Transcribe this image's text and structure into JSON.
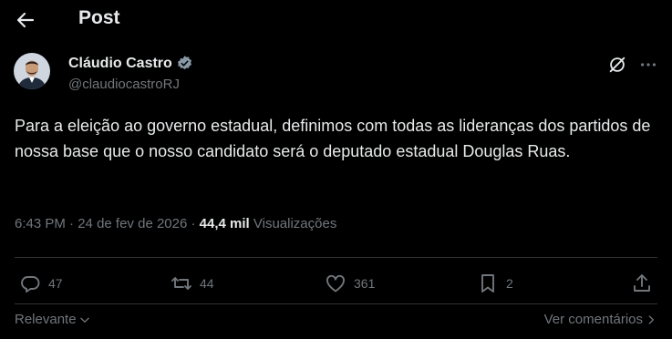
{
  "header": {
    "title": "Post"
  },
  "author": {
    "name": "Cláudio Castro",
    "handle": "@claudiocastroRJ"
  },
  "tweet": {
    "text": "Para a eleição ao governo estadual, definimos com todas as lideranças dos partidos de nossa base que o nosso candidato será o deputado estadual Douglas Ruas.",
    "time": "6:43 PM",
    "sep1": " · ",
    "date": "24 de fev de 2026",
    "sep2": " · ",
    "views_count": "44,4 mil",
    "views_label": " Visualizações"
  },
  "actions": {
    "replies": "47",
    "reposts": "44",
    "likes": "361",
    "bookmarks": "2"
  },
  "footer": {
    "sort_label": "Relevante",
    "view_comments": "Ver comentários"
  },
  "colors": {
    "background": "#000000",
    "text": "#e7e9ea",
    "secondary": "#71767b",
    "verified": "#1d9bf0",
    "divider": "#2f3336"
  },
  "icons": [
    "back-arrow-icon",
    "verified-badge-icon",
    "grok-icon",
    "more-icon",
    "reply-icon",
    "repost-icon",
    "like-icon",
    "bookmark-icon",
    "share-icon",
    "chevron-down-icon",
    "chevron-right-icon"
  ]
}
